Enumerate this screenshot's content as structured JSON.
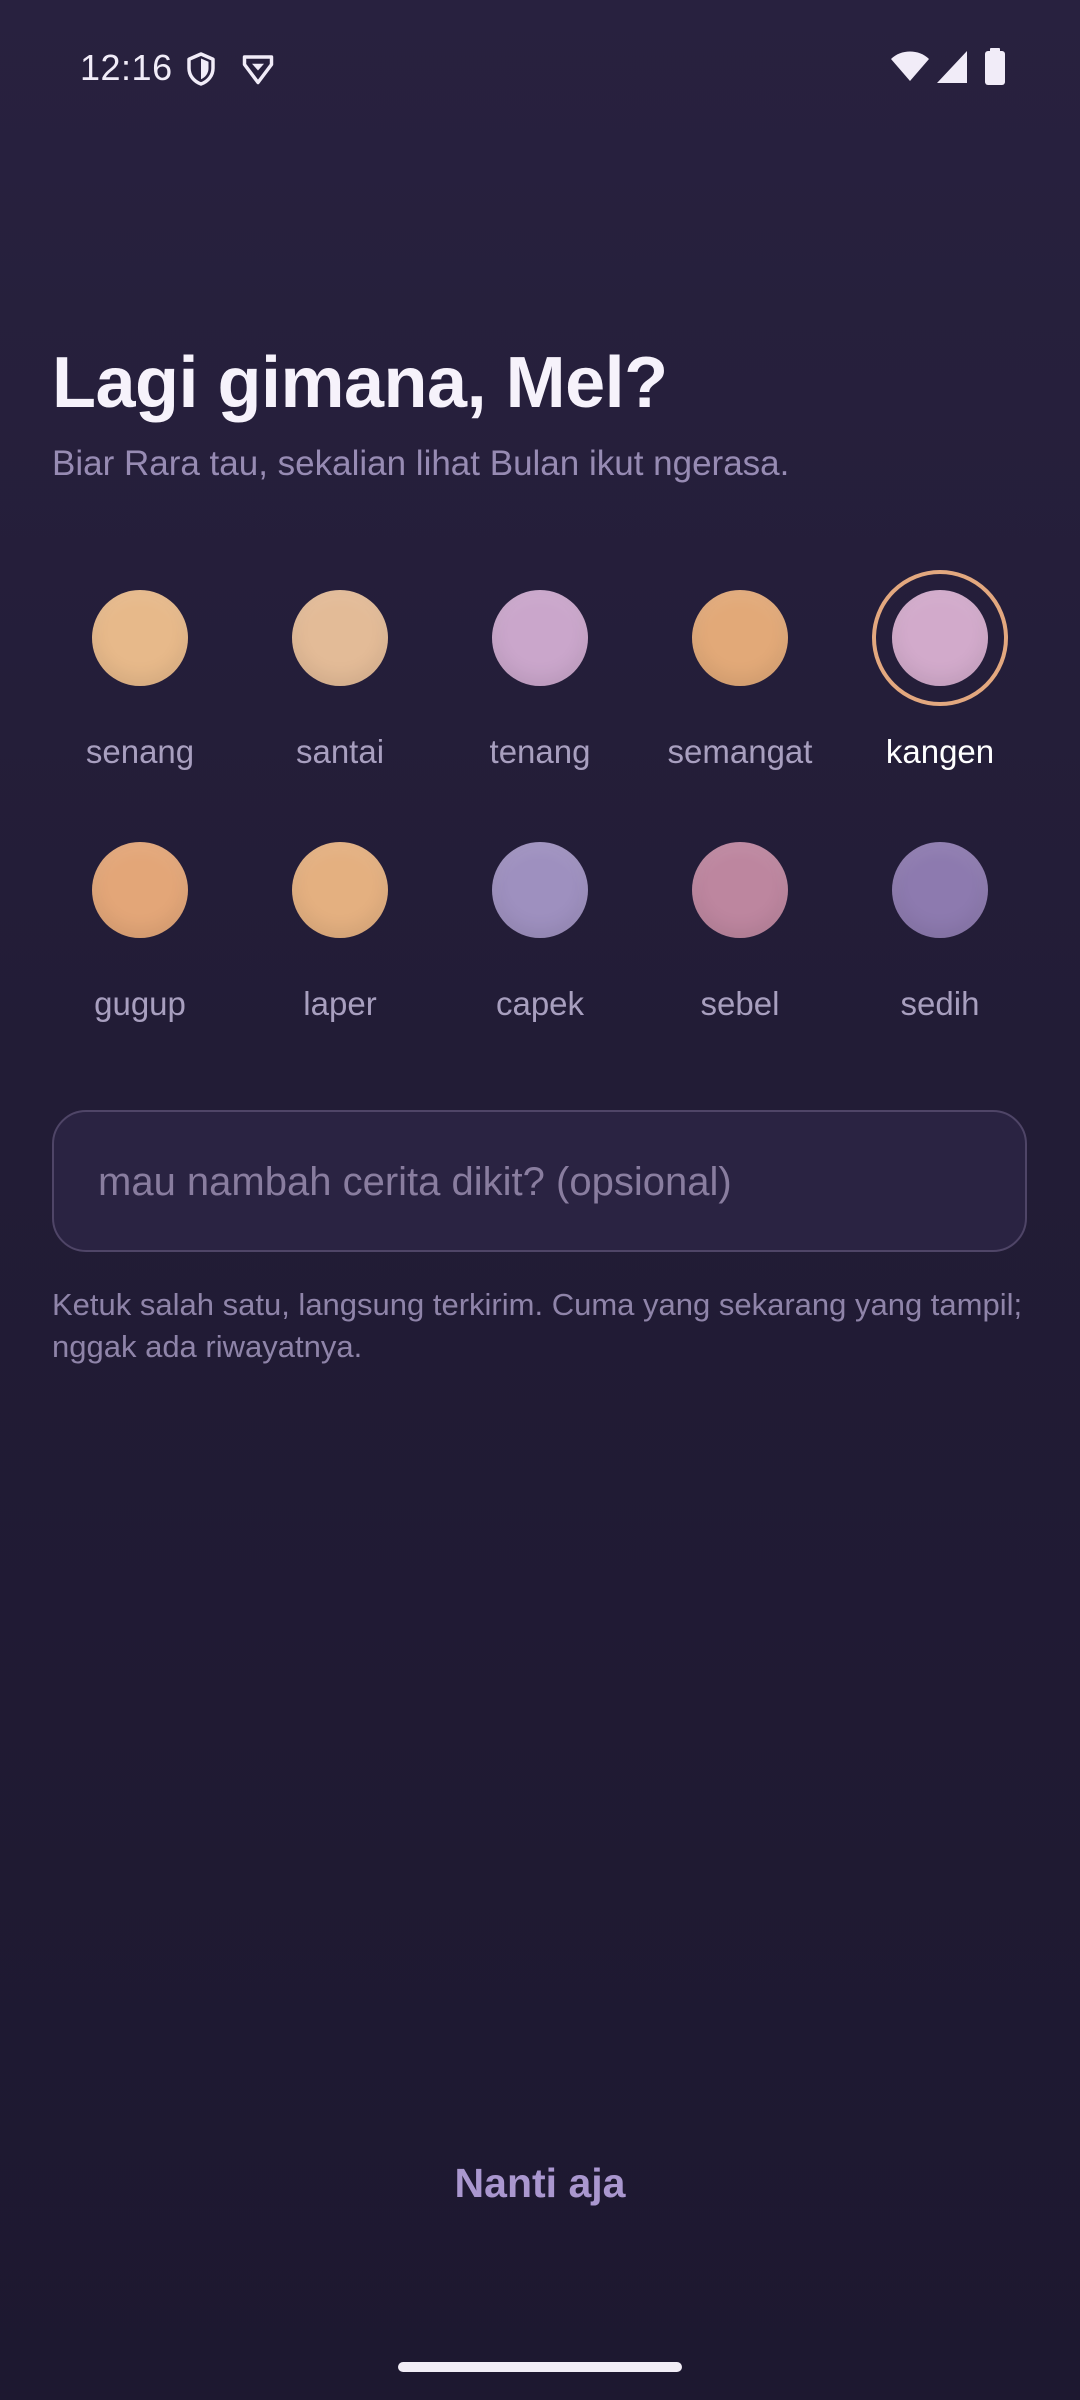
{
  "status_bar": {
    "time": "12:16",
    "left_icons": [
      "shield-icon",
      "vpn-badge-icon"
    ],
    "right_icons": [
      "wifi-icon",
      "cellular-signal-icon",
      "battery-icon"
    ]
  },
  "header": {
    "title": "Lagi gimana, Mel?",
    "subtitle": "Biar Rara tau, sekalian lihat Bulan ikut ngerasa."
  },
  "moods": [
    {
      "label": "senang",
      "color": "#e7b98a",
      "selected": false
    },
    {
      "label": "santai",
      "color": "#e3bb97",
      "selected": false
    },
    {
      "label": "tenang",
      "color": "#caa6cb",
      "selected": false
    },
    {
      "label": "semangat",
      "color": "#e2a978",
      "selected": false
    },
    {
      "label": "kangen",
      "color": "#d2aacb",
      "selected": true
    },
    {
      "label": "gugup",
      "color": "#e3a678",
      "selected": false
    },
    {
      "label": "laper",
      "color": "#e4b080",
      "selected": false
    },
    {
      "label": "capek",
      "color": "#9e90bf",
      "selected": false
    },
    {
      "label": "sebel",
      "color": "#bd869f",
      "selected": false
    },
    {
      "label": "sedih",
      "color": "#8d7aaf",
      "selected": false
    }
  ],
  "story_input": {
    "value": "",
    "placeholder": "mau nambah cerita dikit? (opsional)"
  },
  "hint": "Ketuk salah satu, langsung terkirim. Cuma yang sekarang yang tampil; nggak ada riwayatnya.",
  "later_button": "Nanti aja",
  "colors": {
    "background": "#241d38",
    "selected_ring": "#e3a87f",
    "accent_text": "#aa97cf"
  }
}
